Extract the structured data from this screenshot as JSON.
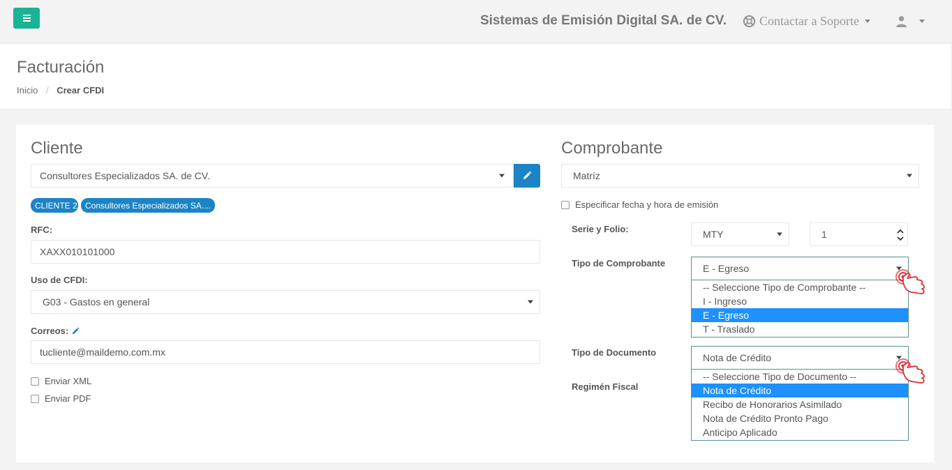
{
  "topbar": {
    "company": "Sistemas de Emisión Digital SA. de CV.",
    "support_label": "Contactar a Soporte",
    "icons": {
      "menu": "hamburger-icon",
      "support": "lifebuoy-icon",
      "user": "user-icon"
    },
    "accent_color": "#1ab394"
  },
  "header": {
    "title": "Facturación",
    "breadcrumb": [
      "Inicio",
      "Crear CFDI"
    ]
  },
  "cliente": {
    "title": "Cliente",
    "selected_client": "Consultores Especializados SA. de CV.",
    "badges": [
      "CLIENTE 2",
      "Consultores Especializados SA...."
    ],
    "rfc_label": "RFC:",
    "rfc_value": "XAXX010101000",
    "uso_label": "Uso de CFDI:",
    "uso_value": "G03 - Gastos en general",
    "correos_label": "Correos:",
    "correos_value": "tucliente@maildemo.com.mx",
    "enviar_xml": "Enviar XML",
    "enviar_pdf": "Enviar PDF"
  },
  "comprobante": {
    "title": "Comprobante",
    "sucursal": "Matríz",
    "fecha_label": "Especificar fecha y hora de emisión",
    "serie_folio_label": "Serie y Folio:",
    "serie": "MTY",
    "folio": "1",
    "tipo_comprobante_label": "Tipo de Comprobante",
    "tipo_comprobante_value": "E - Egreso",
    "tipo_comprobante_options": [
      "-- Seleccione Tipo de Comprobante --",
      "I - Ingreso",
      "E - Egreso",
      "T - Traslado"
    ],
    "tipo_comprobante_selected_index": 2,
    "tipo_documento_label": "Tipo de Documento",
    "tipo_documento_value": "Nota de Crédito",
    "tipo_documento_options": [
      "-- Seleccione Tipo de Documento --",
      "Nota de Crédito",
      "Recibo de Honorarios Asimilado",
      "Nota de Crédito Pronto Pago",
      "Anticipo Aplicado"
    ],
    "tipo_documento_selected_index": 1,
    "regimen_label": "Regimén Fiscal"
  },
  "colors": {
    "primary": "#1c84c6",
    "selected_option": "#1e90ff",
    "hand_cursor": "#e0303a"
  }
}
